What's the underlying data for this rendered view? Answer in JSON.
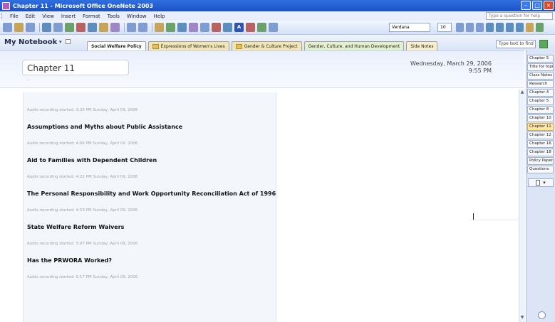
{
  "window": {
    "title": "Chapter 11 - Microsoft Office OneNote 2003",
    "buttons": [
      "minimize",
      "maximize",
      "close"
    ]
  },
  "menu": {
    "items": [
      "File",
      "Edit",
      "View",
      "Insert",
      "Format",
      "Tools",
      "Window",
      "Help"
    ],
    "help_placeholder": "Type a question for help"
  },
  "toolbar": {
    "font": "Verdana",
    "size": "10",
    "highlight_label": "A"
  },
  "notebook": {
    "title": "My Notebook",
    "sections": [
      {
        "label": "Social Welfare Policy",
        "active": true,
        "folder": false
      },
      {
        "label": "Expressions of Women's Lives",
        "active": false,
        "folder": true
      },
      {
        "label": "Gender & Culture Project",
        "active": false,
        "folder": true
      },
      {
        "label": "Gender, Culture, and Human Development",
        "active": false,
        "folder": false
      },
      {
        "label": "Side Notes",
        "active": false,
        "folder": false
      }
    ],
    "find_placeholder": "Type text to find"
  },
  "page": {
    "title": "Chapter 11",
    "date": "Wednesday, March 29, 2006",
    "time": "9:55 PM",
    "notes": [
      {
        "recording": "Audio recording started: 3:35 PM Sunday, April 09, 2006",
        "heading": "Assumptions and Myths about Public Assistance"
      },
      {
        "recording": "Audio recording started: 4:06 PM Sunday, April 09, 2006",
        "heading": "Aid to Families with Dependent Children"
      },
      {
        "recording": "Audio recording started: 4:21 PM Sunday, April 09, 2006",
        "heading": "The Personal Responsibility and Work Opportunity Reconciliation Act of 1996"
      },
      {
        "recording": "Audio recording started: 4:53 PM Sunday, April 09, 2006",
        "heading": "State Welfare Reform Waivers"
      },
      {
        "recording": "Audio recording started: 5:07 PM Sunday, April 09, 2006",
        "heading": "Has the PRWORA Worked?"
      },
      {
        "recording": "Audio recording started: 5:17 PM Sunday, April 09, 2006",
        "heading": ""
      }
    ]
  },
  "page_tabs": [
    {
      "label": "Chapter 5",
      "active": false
    },
    {
      "label": "Title for topi",
      "active": false
    },
    {
      "label": "Class Notes",
      "active": false
    },
    {
      "label": "Research",
      "active": false
    },
    {
      "label": "Chapter 4",
      "active": false
    },
    {
      "label": "Chapter 5",
      "active": false
    },
    {
      "label": "Chapter 8",
      "active": false
    },
    {
      "label": "Chapter 10",
      "active": false
    },
    {
      "label": "Chapter 11",
      "active": true
    },
    {
      "label": "Chapter 12",
      "active": false
    },
    {
      "label": "Chapter 16",
      "active": false
    },
    {
      "label": "Chapter 18",
      "active": false
    },
    {
      "label": "Policy Paper",
      "active": false
    },
    {
      "label": "Questions",
      "active": false
    }
  ],
  "colors": {
    "titlebar": "#2f6fe0",
    "active_page_tab": "#fde6a8"
  }
}
